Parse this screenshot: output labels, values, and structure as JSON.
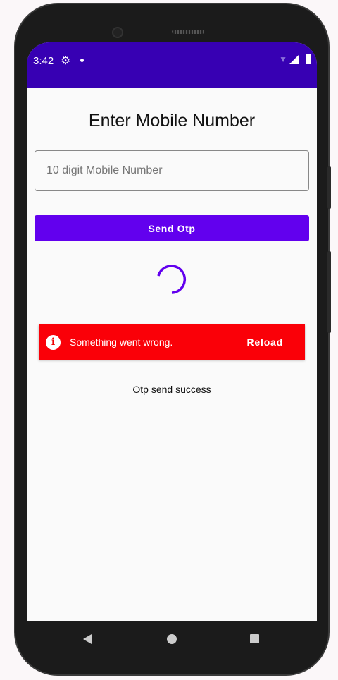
{
  "status_bar": {
    "time": "3:42",
    "icons": [
      "gear-icon",
      "notification-dot-icon",
      "wifi-off-icon",
      "signal-icon",
      "battery-icon"
    ]
  },
  "title": "Enter Mobile Number",
  "mobile_input": {
    "placeholder": "10 digit Mobile Number",
    "value": ""
  },
  "send_button": "Send Otp",
  "snackbar": {
    "message": "Something went wrong.",
    "action": "Reload",
    "icon": "info-icon",
    "color": "#fa0008"
  },
  "status_message": "Otp send success",
  "colors": {
    "primary": "#6200ee",
    "status_bar": "#3700b3"
  },
  "nav_bar": [
    "back",
    "home",
    "recents"
  ]
}
